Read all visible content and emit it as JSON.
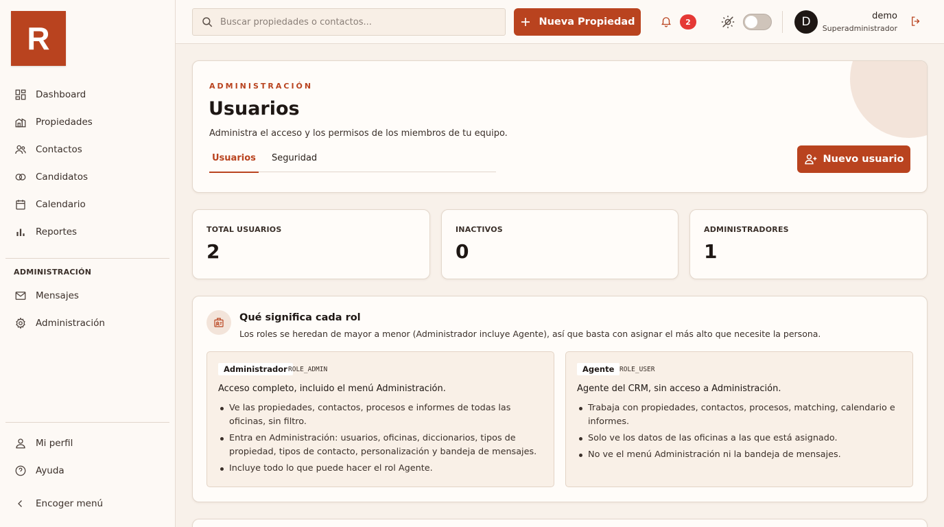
{
  "logo": {
    "letter": "R"
  },
  "sidebar": {
    "items": [
      {
        "label": "Dashboard",
        "icon": "dashboard-icon"
      },
      {
        "label": "Propiedades",
        "icon": "buildings-icon"
      },
      {
        "label": "Contactos",
        "icon": "contacts-icon"
      },
      {
        "label": "Candidatos",
        "icon": "candidates-icon"
      },
      {
        "label": "Calendario",
        "icon": "calendar-icon"
      },
      {
        "label": "Reportes",
        "icon": "bar-chart-icon"
      }
    ],
    "admin_section_title": "ADMINISTRACIÓN",
    "admin_items": [
      {
        "label": "Mensajes",
        "icon": "mail-icon"
      },
      {
        "label": "Administración",
        "icon": "gear-icon"
      }
    ],
    "bottom_items": [
      {
        "label": "Mi perfil",
        "icon": "user-icon"
      },
      {
        "label": "Ayuda",
        "icon": "help-icon"
      },
      {
        "label": "Encoger menú",
        "icon": "chevron-left-icon"
      }
    ]
  },
  "topbar": {
    "search_placeholder": "Buscar propiedades o contactos...",
    "new_property_label": "Nueva Propiedad",
    "notification_count": "2",
    "avatar_letter": "D",
    "user_name": "demo",
    "user_role": "Superadministrador"
  },
  "header": {
    "eyebrow": "ADMINISTRACIÓN",
    "title": "Usuarios",
    "subtitle": "Administra el acceso y los permisos de los miembros de tu equipo.",
    "tabs": [
      {
        "label": "Usuarios",
        "active": true
      },
      {
        "label": "Seguridad",
        "active": false
      }
    ],
    "new_user_label": "Nuevo usuario"
  },
  "stats": [
    {
      "label": "TOTAL USUARIOS",
      "value": "2"
    },
    {
      "label": "INACTIVOS",
      "value": "0"
    },
    {
      "label": "ADMINISTRADORES",
      "value": "1"
    }
  ],
  "roles": {
    "title": "Qué significa cada rol",
    "description": "Los roles se heredan de mayor a menor (Administrador incluye Agente), así que basta con asignar el más alto que necesite la persona.",
    "cards": [
      {
        "name": "Administrador",
        "code": "ROLE_ADMIN",
        "headline": "Acceso completo, incluido el menú Administración.",
        "bullets": [
          "Ve las propiedades, contactos, procesos e informes de todas las oficinas, sin filtro.",
          "Entra en Administración: usuarios, oficinas, diccionarios, tipos de propiedad, tipos de contacto, personalización y bandeja de mensajes.",
          "Incluye todo lo que puede hacer el rol Agente."
        ]
      },
      {
        "name": "Agente",
        "code": "ROLE_USER",
        "headline": "Agente del CRM, sin acceso a Administración.",
        "bullets": [
          "Trabaja con propiedades, contactos, procesos, matching, calendario e informes.",
          "Solo ve los datos de las oficinas a las que está asignado.",
          "No ve el menú Administración ni la bandeja de mensajes."
        ]
      }
    ]
  },
  "colors": {
    "accent": "#b9431f",
    "background": "#f8f1ea",
    "badge": "#e53935"
  }
}
